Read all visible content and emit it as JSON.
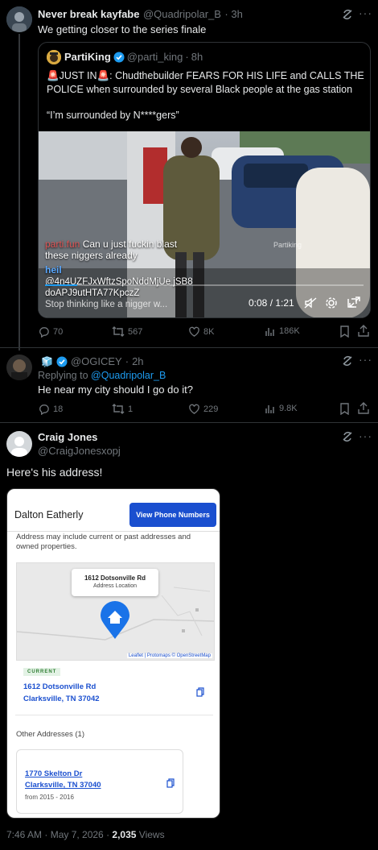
{
  "tweet1": {
    "name": "Never break kayfabe",
    "handle": "@Quadripolar_B",
    "time": "3h",
    "text": "We getting closer to the series finale",
    "quote": {
      "name": "PartiKing",
      "handle": "@parti_king",
      "time": "8h",
      "line1": "🚨JUST IN🚨: Chudthebuilder FEARS FOR HIS LIFE and CALLS THE POLICE when surrounded by several Black people at the gas station",
      "line2": "“I’m surrounded by N****gers”",
      "video": {
        "chat_user1": "parti.fun",
        "chat_msg1": "Can u just fuckin blast these niggers already",
        "chat_user2": "heil",
        "chat_msg2": "@4n4UZFJxWftzSpoNddMjUe jSB8doAPJ9utHTA77KpczZ",
        "chat_msg3": "Stop thinking like a nigger w...",
        "watermark": "Partiking",
        "time": "0:08 / 1:21"
      }
    },
    "replies": "70",
    "reposts": "567",
    "likes": "8K",
    "views": "186K"
  },
  "tweet2": {
    "name": "",
    "handle": "@OGICEY",
    "time": "2h",
    "replying_prefix": "Replying to",
    "replying_handle": "@Quadripolar_B",
    "text": "He near my city should I go do it?",
    "replies": "18",
    "reposts": "1",
    "likes": "229",
    "views": "9.8K"
  },
  "tweet3": {
    "name": "Craig Jones",
    "handle": "@CraigJonesxopj",
    "text": "Here's his address!",
    "card": {
      "person": "Dalton Eatherly",
      "button": "View Phone Numbers",
      "note": "Address may include current or past addresses and owned properties.",
      "map_address": "1612 Dotsonville Rd",
      "map_sub": "Address Location",
      "map_credit": "Leaflet | Protomaps © OpenStreetMap",
      "current_badge": "CURRENT",
      "cur_line1": "1612 Dotsonville Rd",
      "cur_line2": "Clarksville, TN 37042",
      "other_title": "Other Addresses (1)",
      "other_line1": "1770 Skelton Dr",
      "other_line2": "Clarksville, TN 37040",
      "other_dates": "from 2015 - 2016"
    },
    "timestamp": "7:46 AM · May 7, 2026 ·",
    "views_count": "2,035",
    "views_label": "Views"
  },
  "colors": {
    "link": "#1d9bf0",
    "verified": "#1d9bf0",
    "card_blue": "#1a4fcf"
  }
}
